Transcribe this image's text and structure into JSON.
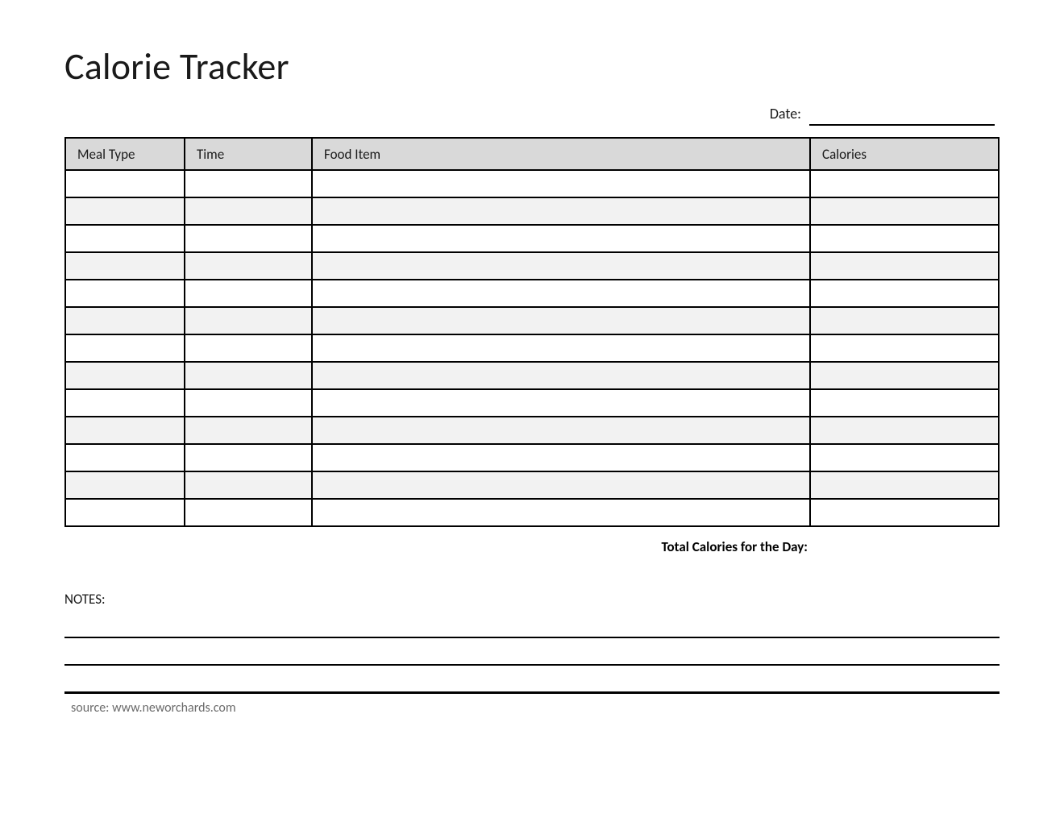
{
  "title": "Calorie Tracker",
  "date_label": "Date:",
  "date_value": "",
  "columns": {
    "meal_type": "Meal Type",
    "time": "Time",
    "food_item": "Food Item",
    "calories": "Calories"
  },
  "rows": [
    {
      "meal_type": "",
      "time": "",
      "food_item": "",
      "calories": ""
    },
    {
      "meal_type": "",
      "time": "",
      "food_item": "",
      "calories": ""
    },
    {
      "meal_type": "",
      "time": "",
      "food_item": "",
      "calories": ""
    },
    {
      "meal_type": "",
      "time": "",
      "food_item": "",
      "calories": ""
    },
    {
      "meal_type": "",
      "time": "",
      "food_item": "",
      "calories": ""
    },
    {
      "meal_type": "",
      "time": "",
      "food_item": "",
      "calories": ""
    },
    {
      "meal_type": "",
      "time": "",
      "food_item": "",
      "calories": ""
    },
    {
      "meal_type": "",
      "time": "",
      "food_item": "",
      "calories": ""
    },
    {
      "meal_type": "",
      "time": "",
      "food_item": "",
      "calories": ""
    },
    {
      "meal_type": "",
      "time": "",
      "food_item": "",
      "calories": ""
    },
    {
      "meal_type": "",
      "time": "",
      "food_item": "",
      "calories": ""
    },
    {
      "meal_type": "",
      "time": "",
      "food_item": "",
      "calories": ""
    },
    {
      "meal_type": "",
      "time": "",
      "food_item": "",
      "calories": ""
    }
  ],
  "total_label": "Total Calories for the Day:",
  "notes_label": "NOTES:",
  "source_text": "source: www.neworchards.com"
}
